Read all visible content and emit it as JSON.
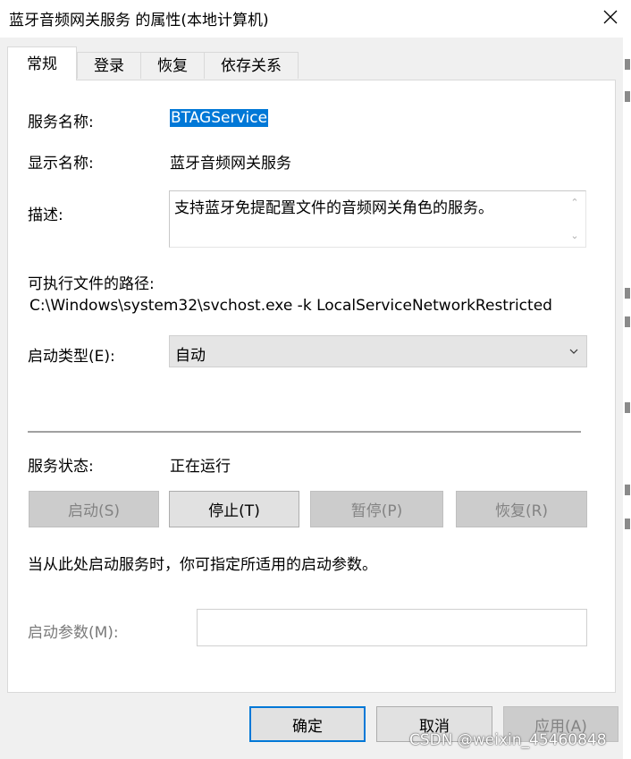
{
  "window": {
    "title": "蓝牙音频网关服务 的属性(本地计算机)"
  },
  "tabs": [
    {
      "label": "常规",
      "active": true
    },
    {
      "label": "登录",
      "active": false
    },
    {
      "label": "恢复",
      "active": false
    },
    {
      "label": "依存关系",
      "active": false
    }
  ],
  "general": {
    "service_name_label": "服务名称:",
    "service_name_value": "BTAGService",
    "display_name_label": "显示名称:",
    "display_name_value": "蓝牙音频网关服务",
    "description_label": "描述:",
    "description_value": "支持蓝牙免提配置文件的音频网关角色的服务。",
    "path_label": "可执行文件的路径:",
    "path_value": "C:\\Windows\\system32\\svchost.exe -k LocalServiceNetworkRestricted",
    "startup_type_label": "启动类型(E):",
    "startup_type_value": "自动",
    "status_label": "服务状态:",
    "status_value": "正在运行",
    "buttons": {
      "start": "启动(S)",
      "stop": "停止(T)",
      "pause": "暂停(P)",
      "resume": "恢复(R)"
    },
    "hint": "当从此处启动服务时，你可指定所适用的启动参数。",
    "params_label": "启动参数(M):",
    "params_value": ""
  },
  "dialog_buttons": {
    "ok": "确定",
    "cancel": "取消",
    "apply": "应用(A)"
  },
  "watermark": "CSDN @weixin_45460848",
  "colors": {
    "selection": "#0078d7",
    "default_button_border": "#0078d7"
  }
}
